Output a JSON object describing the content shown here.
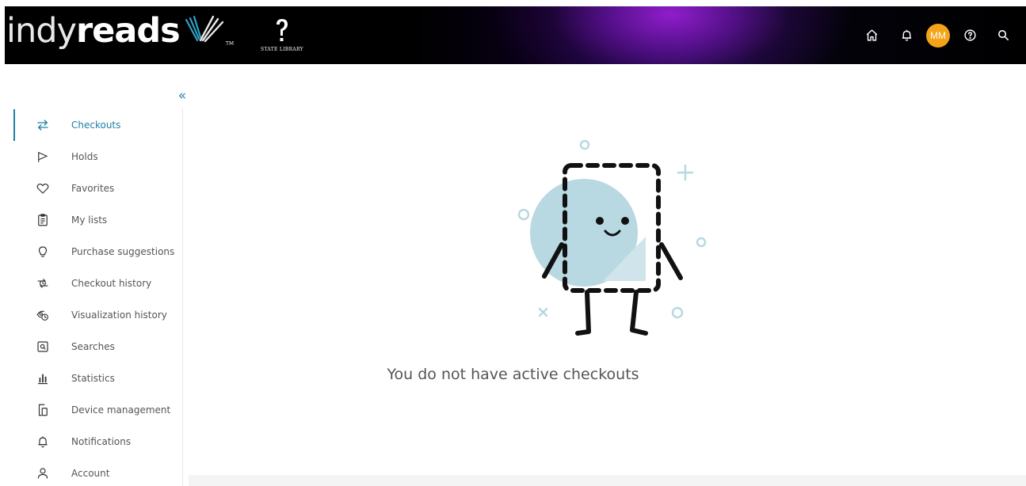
{
  "header": {
    "logo_thin": "indy",
    "logo_bold": "reads",
    "logo_tm": "TM",
    "state_library": "STATE LIBRARY",
    "user_initials": "MM",
    "icons": [
      "home-icon",
      "bell-icon",
      "help-icon",
      "search-icon"
    ]
  },
  "colors": {
    "accent": "#1d7fa3",
    "avatar": "#f4a418",
    "illustration_circle": "#b8d8e2"
  },
  "sidebar": {
    "collapse_label": "«",
    "items": [
      {
        "label": "Checkouts",
        "icon": "swap-arrows-icon",
        "active": true
      },
      {
        "label": "Holds",
        "icon": "flag-icon"
      },
      {
        "label": "Favorites",
        "icon": "heart-icon"
      },
      {
        "label": "My lists",
        "icon": "clipboard-icon"
      },
      {
        "label": "Purchase suggestions",
        "icon": "lightbulb-icon"
      },
      {
        "label": "Checkout history",
        "icon": "history-icon"
      },
      {
        "label": "Visualization history",
        "icon": "eye-history-icon"
      },
      {
        "label": "Searches",
        "icon": "search-box-icon"
      },
      {
        "label": "Statistics",
        "icon": "bar-chart-icon"
      },
      {
        "label": "Device management",
        "icon": "devices-icon"
      },
      {
        "label": "Notifications",
        "icon": "bell-icon"
      },
      {
        "label": "Account",
        "icon": "user-icon"
      }
    ]
  },
  "main": {
    "empty_message": "You do not have active checkouts"
  }
}
